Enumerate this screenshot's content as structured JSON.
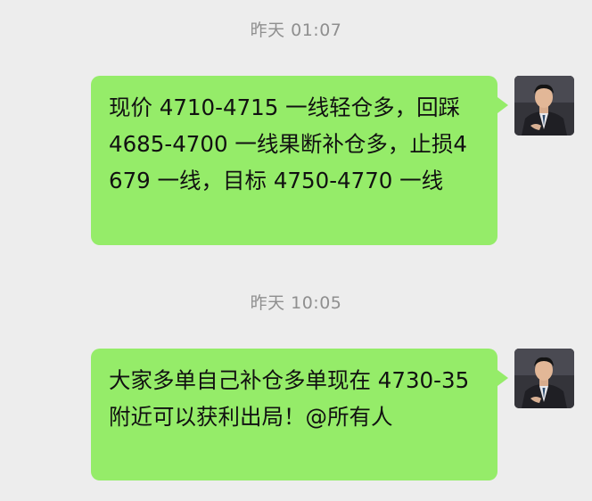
{
  "messages": [
    {
      "timestamp": "昨天 01:07",
      "text": "现价 4710-4715 一线轻仓多，回踩 4685-4700 一线果断补仓多，止损4679 一线，目标 4750-4770 一线",
      "avatar_icon": "user-avatar"
    },
    {
      "timestamp": "昨天 10:05",
      "text": "大家多单自己补仓多单现在 4730-35 附近可以获利出局！@所有人",
      "avatar_icon": "user-avatar"
    }
  ],
  "colors": {
    "background": "#ededed",
    "bubble": "#95ec69",
    "timestamp": "#8f8f8f",
    "text": "#111111"
  }
}
